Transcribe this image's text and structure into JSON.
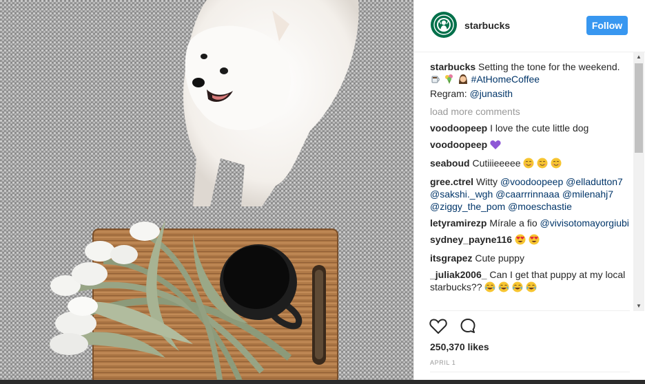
{
  "post": {
    "username": "starbucks",
    "follow_label": "Follow",
    "caption": {
      "username": "starbucks",
      "text": "Setting the tone for the weekend.",
      "hashtag": "#AtHomeCoffee",
      "regram_label": "Regram:",
      "regram_user": "@junasith"
    },
    "load_more": "load more comments",
    "comments": [
      {
        "user": "voodoopeep",
        "text": "I love the cute little dog"
      },
      {
        "user": "voodoopeep",
        "text": ""
      },
      {
        "user": "seaboud",
        "text": "Cutiiieeeee"
      },
      {
        "user": "gree.ctrel",
        "text": "Witty",
        "mentions": [
          "@voodoopeep",
          "@elladutton7",
          "@sakshi._wgh",
          "@caarrrinnaaa",
          "@milenahj7",
          "@ziggy_the_pom",
          "@moeschastie"
        ]
      },
      {
        "user": "letyramirezp",
        "text": "Mírale a fio",
        "mentions": [
          "@vivisotomayorgiubi"
        ]
      },
      {
        "user": "sydney_payne116",
        "text": ""
      },
      {
        "user": "itsgrapez",
        "text": "Cute puppy"
      },
      {
        "user": "_juliak2006_",
        "text": "Can I get that puppy at my local starbucks??"
      }
    ],
    "likes": "250,370 likes",
    "date": "APRIL 1",
    "icons": [
      "heart-icon",
      "comment-icon"
    ],
    "colors": {
      "follow": "#3897f0",
      "link": "#003569",
      "muted": "#999999",
      "brand": "#00704a"
    }
  }
}
